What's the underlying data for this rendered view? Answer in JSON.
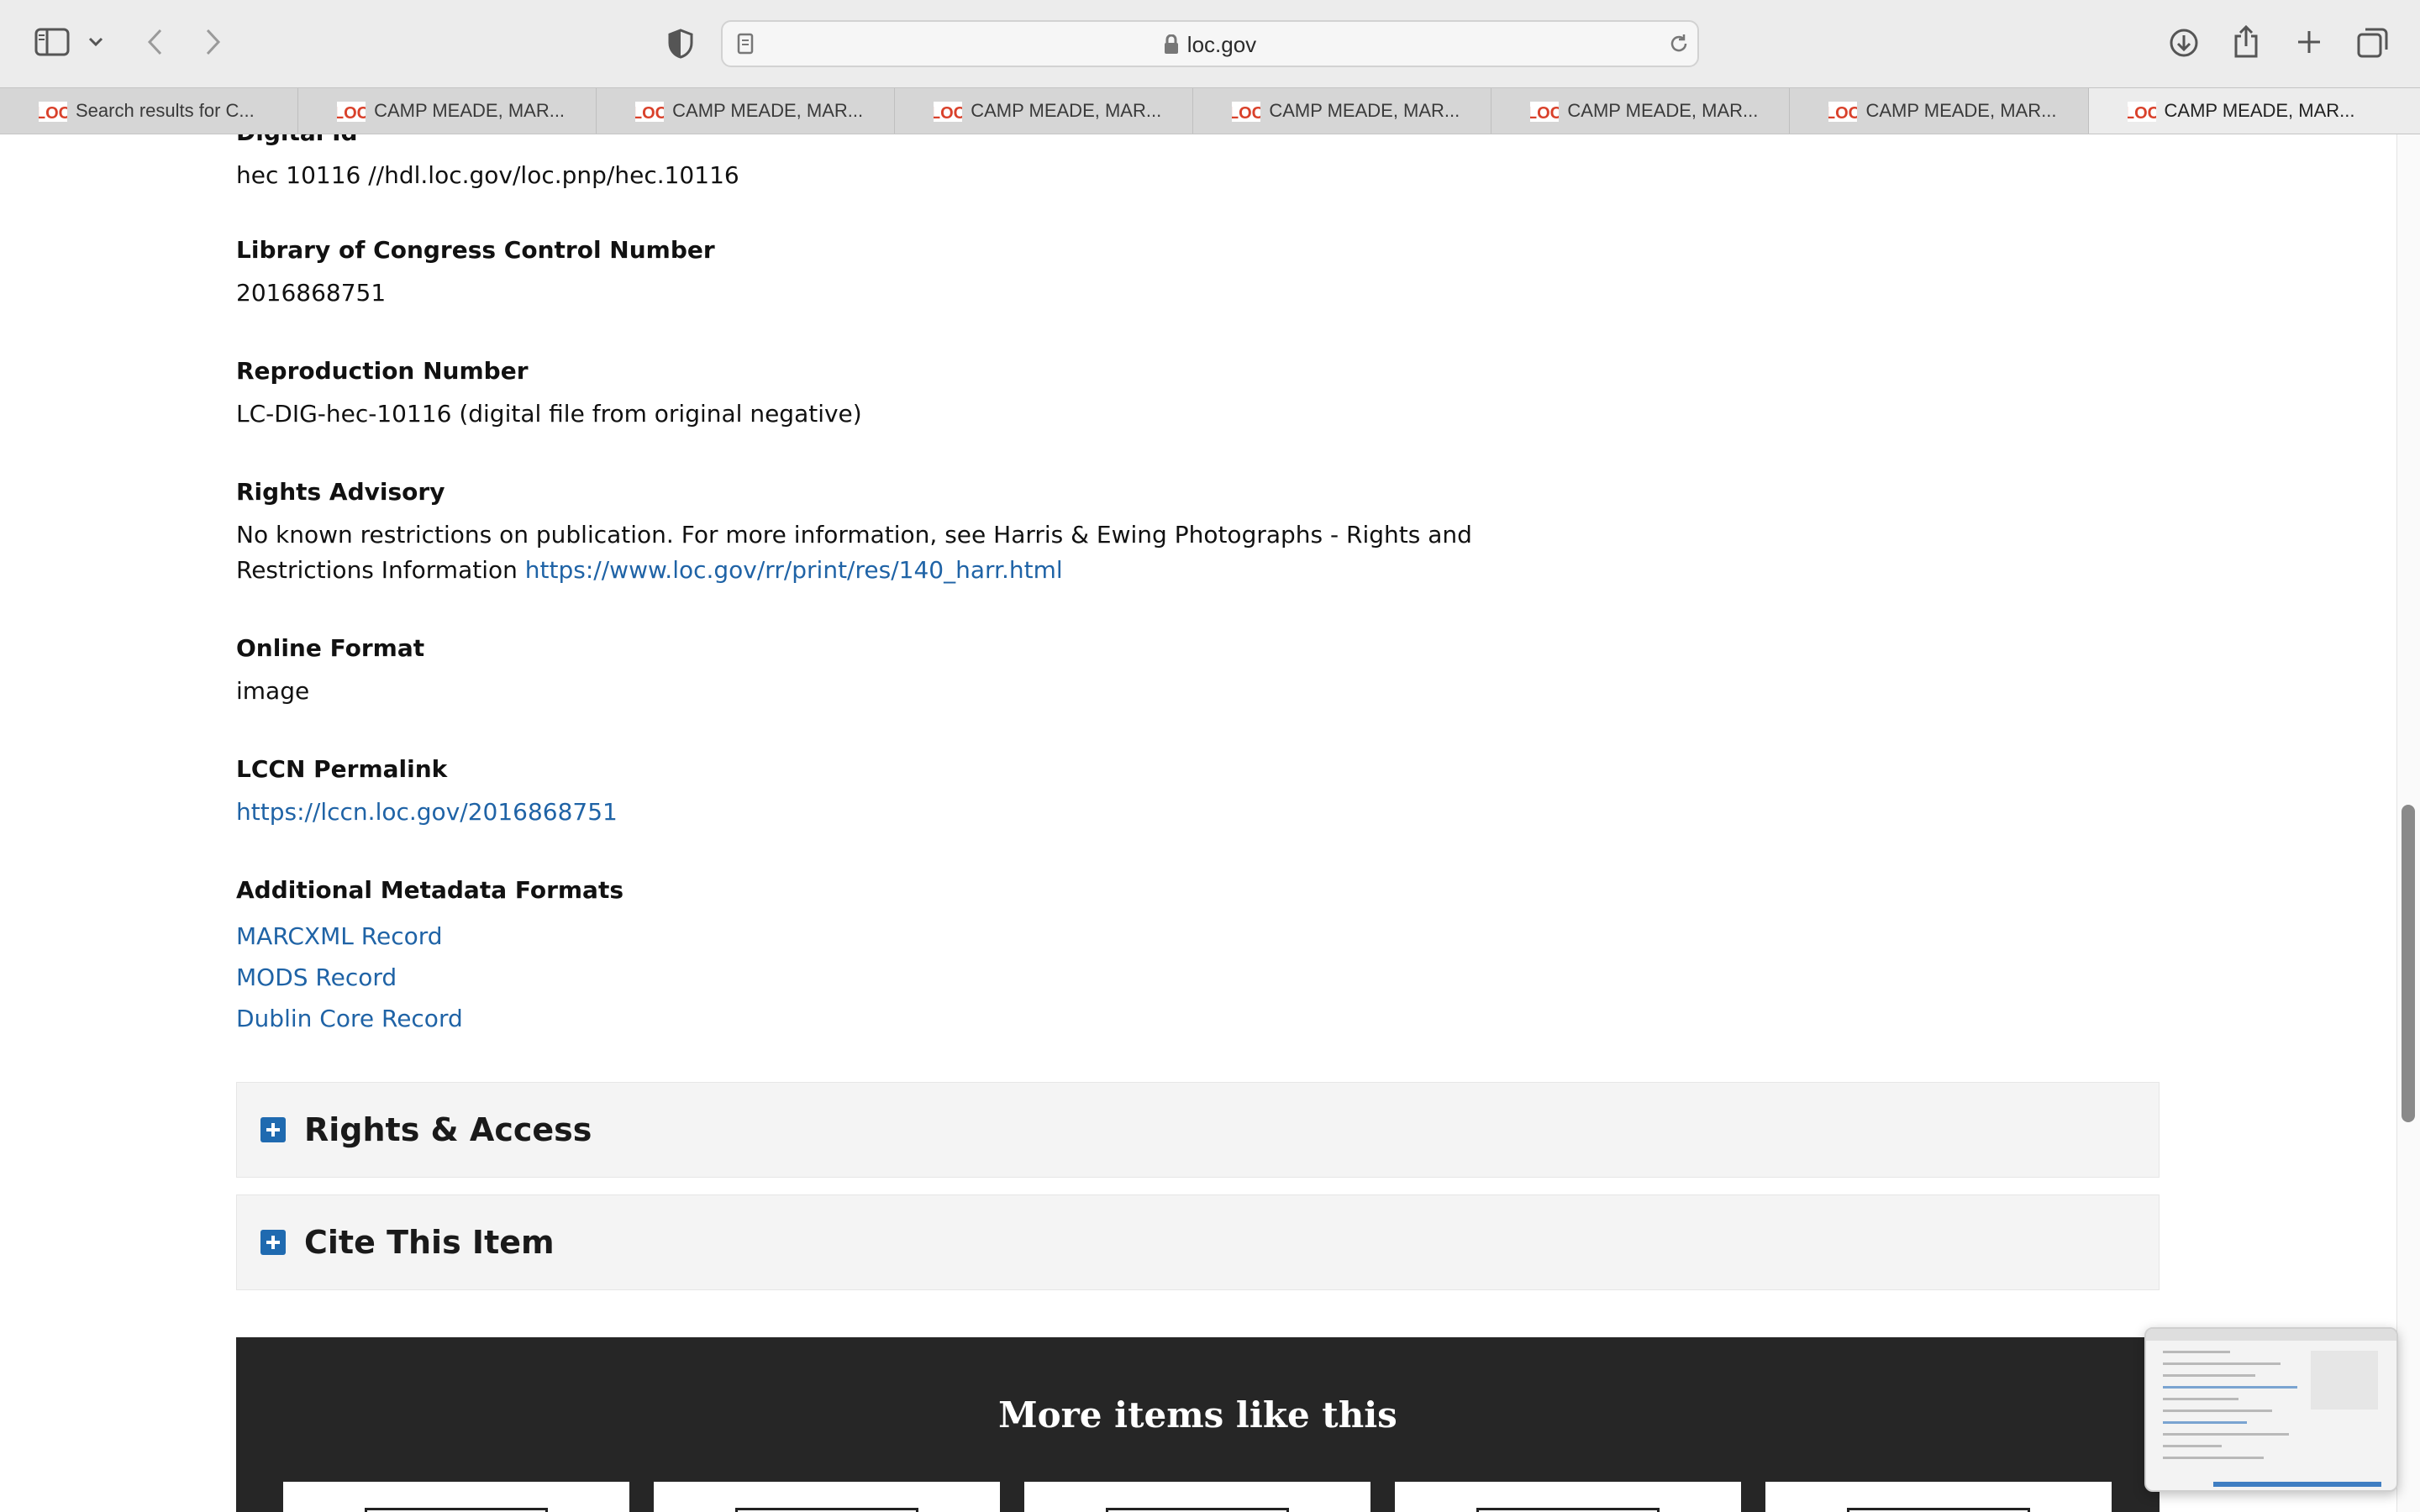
{
  "browser": {
    "address": "loc.gov",
    "tabs": [
      {
        "title": "Search results for C...",
        "active": false
      },
      {
        "title": "CAMP MEADE, MAR...",
        "active": false
      },
      {
        "title": "CAMP MEADE, MAR...",
        "active": false
      },
      {
        "title": "CAMP MEADE, MAR...",
        "active": false
      },
      {
        "title": "CAMP MEADE, MAR...",
        "active": false
      },
      {
        "title": "CAMP MEADE, MAR...",
        "active": false
      },
      {
        "title": "CAMP MEADE, MAR...",
        "active": false
      },
      {
        "title": "CAMP MEADE, MAR...",
        "active": true
      }
    ],
    "favicon_text": "LOC",
    "favicon_color": "#d9412b"
  },
  "record": {
    "digital_id": {
      "label": "Digital Id",
      "value": "hec 10116 //hdl.loc.gov/loc.pnp/hec.10116"
    },
    "lccn": {
      "label": "Library of Congress Control Number",
      "value": "2016868751"
    },
    "reproduction": {
      "label": "Reproduction Number",
      "value": "LC-DIG-hec-10116 (digital file from original negative)"
    },
    "rights": {
      "label": "Rights Advisory",
      "text_line1": "No known restrictions on publication. For more information, see Harris & Ewing Photographs - Rights and",
      "text_line2": "Restrictions Information",
      "link": "https://www.loc.gov/rr/print/res/140_harr.html"
    },
    "online_format": {
      "label": "Online Format",
      "value": "image"
    },
    "permalink": {
      "label": "LCCN Permalink",
      "link": "https://lccn.loc.gov/2016868751"
    },
    "metadata_formats": {
      "label": "Additional Metadata Formats",
      "links": [
        "MARCXML Record",
        "MODS Record",
        "Dublin Core Record"
      ]
    }
  },
  "accordions": {
    "rights_access": "Rights & Access",
    "cite": "Cite This Item"
  },
  "more_items": {
    "title": "More items like this"
  },
  "colors": {
    "link": "#1f63a6",
    "accordion_icon": "#1f6ab0",
    "more_bg": "#262626"
  }
}
